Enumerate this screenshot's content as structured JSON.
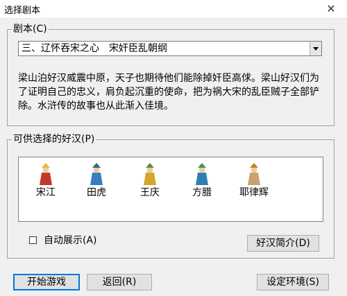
{
  "window": {
    "title": "选择剧本",
    "close_glyph": "✕"
  },
  "script_group": {
    "label": "剧本(C)",
    "selected": "三、辽怀吞宋之心　宋奸臣乱朝纲",
    "description": "梁山泊好汉威震中原，天子也期待他们能除掉奸臣高俅。梁山好汉们为了证明自己的忠义，肩负起沉重的使命，把为祸大宋的乱臣贼子全部铲除。水浒传的故事也从此渐入佳境。"
  },
  "heroes_group": {
    "label": "可供选择的好汉(P)",
    "heroes": [
      {
        "name": "宋江",
        "robe": "#c0392b",
        "hat": "#e8b93c"
      },
      {
        "name": "田虎",
        "robe": "#3a7bbf",
        "hat": "#2c6e6a"
      },
      {
        "name": "王庆",
        "robe": "#d4a72c",
        "hat": "#5a8f3a"
      },
      {
        "name": "方腊",
        "robe": "#2e7fae",
        "hat": "#3c9a5a"
      },
      {
        "name": "耶律辉",
        "robe": "#c9a36b",
        "hat": "#b8872f"
      }
    ],
    "auto_show_label": "自动展示(A)",
    "intro_button": "好汉简介(D)"
  },
  "buttons": {
    "start": "开始游戏",
    "back": "返回(R)",
    "settings": "设定环境(S)"
  }
}
